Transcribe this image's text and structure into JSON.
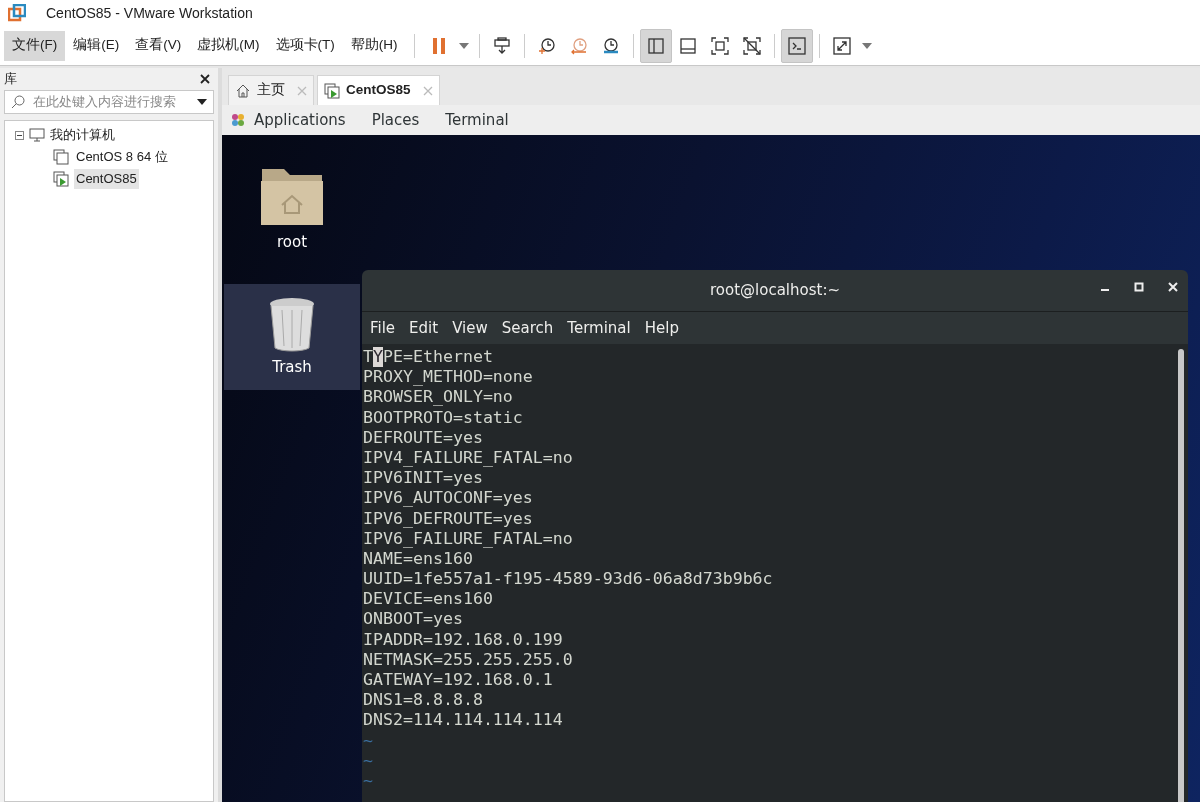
{
  "window": {
    "title": "CentOS85 - VMware Workstation"
  },
  "menubar": [
    {
      "label": "文件(F)",
      "selected": true
    },
    {
      "label": "编辑(E)",
      "selected": false
    },
    {
      "label": "查看(V)",
      "selected": false
    },
    {
      "label": "虚拟机(M)",
      "selected": false
    },
    {
      "label": "选项卡(T)",
      "selected": false
    },
    {
      "label": "帮助(H)",
      "selected": false
    }
  ],
  "toolbar": [
    {
      "kind": "pause",
      "selected": false
    },
    {
      "kind": "caret",
      "selected": false
    },
    {
      "kind": "sep"
    },
    {
      "kind": "send-keys",
      "selected": false
    },
    {
      "kind": "sep"
    },
    {
      "kind": "snapshot",
      "selected": false
    },
    {
      "kind": "revert",
      "selected": false
    },
    {
      "kind": "manage",
      "selected": false
    },
    {
      "kind": "sep"
    },
    {
      "kind": "library-view",
      "selected": true
    },
    {
      "kind": "thumb-view",
      "selected": false
    },
    {
      "kind": "full",
      "selected": false
    },
    {
      "kind": "unity",
      "selected": false
    },
    {
      "kind": "sep"
    },
    {
      "kind": "console",
      "selected": true
    },
    {
      "kind": "sep"
    },
    {
      "kind": "stretch",
      "selected": false
    },
    {
      "kind": "caret",
      "selected": false
    }
  ],
  "library": {
    "title": "库",
    "search": {
      "placeholder": "在此处键入内容进行搜索"
    },
    "tree": [
      {
        "label": "我的计算机",
        "expanded": true,
        "children": [
          {
            "label": "CentOS 8 64 位",
            "kind": "vm",
            "selected": false
          },
          {
            "label": "CentOS85",
            "kind": "vm-running",
            "selected": true
          }
        ]
      }
    ]
  },
  "tabs": [
    {
      "label": "主页",
      "kind": "home",
      "selected": false
    },
    {
      "label": "CentOS85",
      "kind": "vm",
      "selected": true
    }
  ],
  "gnome_bar": {
    "items": [
      "Applications",
      "Places",
      "Terminal"
    ]
  },
  "desktop_icons": [
    {
      "label": "root",
      "kind": "folder",
      "selected": false
    },
    {
      "label": "Trash",
      "kind": "trash",
      "selected": true
    }
  ],
  "terminal": {
    "title": "root@localhost:~",
    "menu": [
      "File",
      "Edit",
      "View",
      "Search",
      "Terminal",
      "Help"
    ],
    "lines": [
      {
        "text": "TYPE=Ethernet",
        "kind": "text",
        "cursor": true
      },
      {
        "text": "PROXY_METHOD=none",
        "kind": "text",
        "cursor": false
      },
      {
        "text": "BROWSER_ONLY=no",
        "kind": "text",
        "cursor": false
      },
      {
        "text": "BOOTPROTO=static",
        "kind": "text",
        "cursor": false
      },
      {
        "text": "DEFROUTE=yes",
        "kind": "text",
        "cursor": false
      },
      {
        "text": "IPV4_FAILURE_FATAL=no",
        "kind": "text",
        "cursor": false
      },
      {
        "text": "IPV6INIT=yes",
        "kind": "text",
        "cursor": false
      },
      {
        "text": "IPV6_AUTOCONF=yes",
        "kind": "text",
        "cursor": false
      },
      {
        "text": "IPV6_DEFROUTE=yes",
        "kind": "text",
        "cursor": false
      },
      {
        "text": "IPV6_FAILURE_FATAL=no",
        "kind": "text",
        "cursor": false
      },
      {
        "text": "NAME=ens160",
        "kind": "text",
        "cursor": false
      },
      {
        "text": "UUID=1fe557a1-f195-4589-93d6-06a8d73b9b6c",
        "kind": "text",
        "cursor": false
      },
      {
        "text": "DEVICE=ens160",
        "kind": "text",
        "cursor": false
      },
      {
        "text": "ONBOOT=yes",
        "kind": "text",
        "cursor": false
      },
      {
        "text": "IPADDR=192.168.0.199",
        "kind": "text",
        "cursor": false
      },
      {
        "text": "NETMASK=255.255.255.0",
        "kind": "text",
        "cursor": false
      },
      {
        "text": "GATEWAY=192.168.0.1",
        "kind": "text",
        "cursor": false
      },
      {
        "text": "DNS1=8.8.8.8",
        "kind": "text",
        "cursor": false
      },
      {
        "text": "DNS2=114.114.114.114",
        "kind": "text",
        "cursor": false
      },
      {
        "text": "~",
        "kind": "filler",
        "cursor": false
      },
      {
        "text": "~",
        "kind": "filler",
        "cursor": false
      },
      {
        "text": "~",
        "kind": "filler",
        "cursor": false
      }
    ]
  }
}
